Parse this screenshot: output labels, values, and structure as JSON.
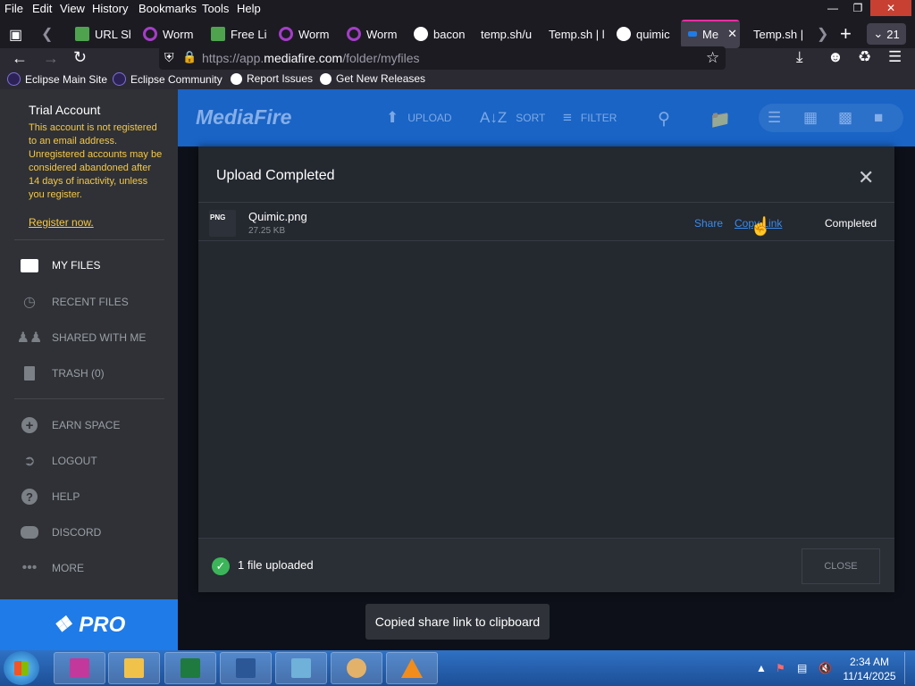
{
  "browser": {
    "menu": [
      "File",
      "Edit",
      "View",
      "History",
      "Bookmarks",
      "Tools",
      "Help"
    ],
    "tabs": [
      {
        "label": "URL Sh",
        "color": "#4fa34f"
      },
      {
        "label": "Worm",
        "color": "#a43ec7"
      },
      {
        "label": "Free Li",
        "color": "#4fa34f"
      },
      {
        "label": "Worm",
        "color": "#a43ec7"
      },
      {
        "label": "Worm",
        "color": "#a43ec7"
      },
      {
        "label": "bacon",
        "color": "#ffffff"
      },
      {
        "label": "temp.sh/u",
        "color": ""
      },
      {
        "label": "Temp.sh | l",
        "color": ""
      },
      {
        "label": "quimic",
        "color": "#ffffff"
      },
      {
        "label": "Me",
        "color": "#1f7be8"
      },
      {
        "label": "Temp.sh | (",
        "color": ""
      }
    ],
    "tab_count": "21",
    "url_prefix": "https://app.",
    "url_domain": "mediafire.com",
    "url_path": "/folder/myfiles",
    "bookmarks": [
      {
        "label": "Eclipse Main Site",
        "color": "#2c2255"
      },
      {
        "label": "Eclipse Community",
        "color": "#2c2255"
      },
      {
        "label": "Report Issues",
        "color": "#ffffff"
      },
      {
        "label": "Get New Releases",
        "color": "#ffffff"
      }
    ]
  },
  "sidebar": {
    "trial_title": "Trial Account",
    "trial_message": "This account is not registered to an email address. Unregistered accounts may be considered abandoned after 14 days of inactivity, unless you register.",
    "register_link": "Register now.",
    "items": [
      {
        "label": "MY FILES",
        "icon": "folder-icon"
      },
      {
        "label": "RECENT FILES",
        "icon": "clock-icon"
      },
      {
        "label": "SHARED WITH ME",
        "icon": "people-icon"
      },
      {
        "label": "TRASH (0)",
        "icon": "trash-icon"
      },
      {
        "label": "EARN SPACE",
        "icon": "plus-circle-icon"
      },
      {
        "label": "LOGOUT",
        "icon": "logout-icon"
      },
      {
        "label": "HELP",
        "icon": "help-icon"
      },
      {
        "label": "DISCORD",
        "icon": "discord-icon"
      },
      {
        "label": "MORE",
        "icon": "more-icon"
      }
    ],
    "pro_label": "PRO"
  },
  "header": {
    "logo": "MediaFire",
    "upload": "UPLOAD",
    "sort": "SORT",
    "filter": "FILTER"
  },
  "modal": {
    "title": "Upload Completed",
    "file": {
      "type": "PNG",
      "name": "Quimic.png",
      "size": "27.25 KB",
      "share": "Share",
      "copy_link": "Copy Link",
      "status": "Completed"
    },
    "footer_count": "1 file uploaded",
    "close_button": "CLOSE"
  },
  "toast": "Copied share link to clipboard",
  "taskbar": {
    "time": "2:34 AM",
    "date": "11/14/2025"
  }
}
